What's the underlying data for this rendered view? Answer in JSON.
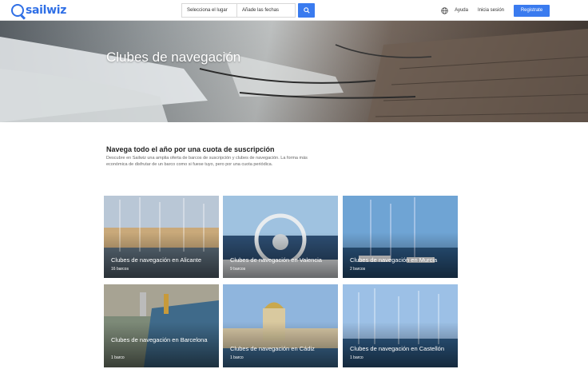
{
  "header": {
    "logo_text": "sailwiz",
    "search": {
      "place_label": "Selecciona el lugar",
      "dates_label": "Añade las fechas"
    },
    "nav": {
      "help_label": "Ayuda",
      "login_label": "Inicia sesión",
      "register_label": "Registrate"
    }
  },
  "hero": {
    "title": "Clubes de navegación"
  },
  "intro": {
    "title": "Navega todo el año por una cuota de suscripción",
    "text": "Descubre en Sailwiz una amplia oferta de barcos de suscripción y clubes de navegación. La forma más económica de disfrutar de un barco como si fuese tuyo, pero por una cuota periódica."
  },
  "cards": [
    {
      "title": "Clubes de navegación en Alicante",
      "count": "16 barcos"
    },
    {
      "title": "Clubes de navegación en Valencia",
      "count": "9 barcos"
    },
    {
      "title": "Clubes de navegación en Murcia",
      "count": "2 barcos"
    },
    {
      "title": "Clubes de navegación en Barcelona",
      "count": "1 barco"
    },
    {
      "title": "Clubes de navegación en Cádiz",
      "count": "1 barco"
    },
    {
      "title": "Clubes de navegación en Castellón",
      "count": "1 barco"
    }
  ],
  "colors": {
    "brand": "#2f6fe6",
    "button": "#3a7bef"
  },
  "icons": {
    "search": "search-icon",
    "globe": "globe-icon"
  }
}
